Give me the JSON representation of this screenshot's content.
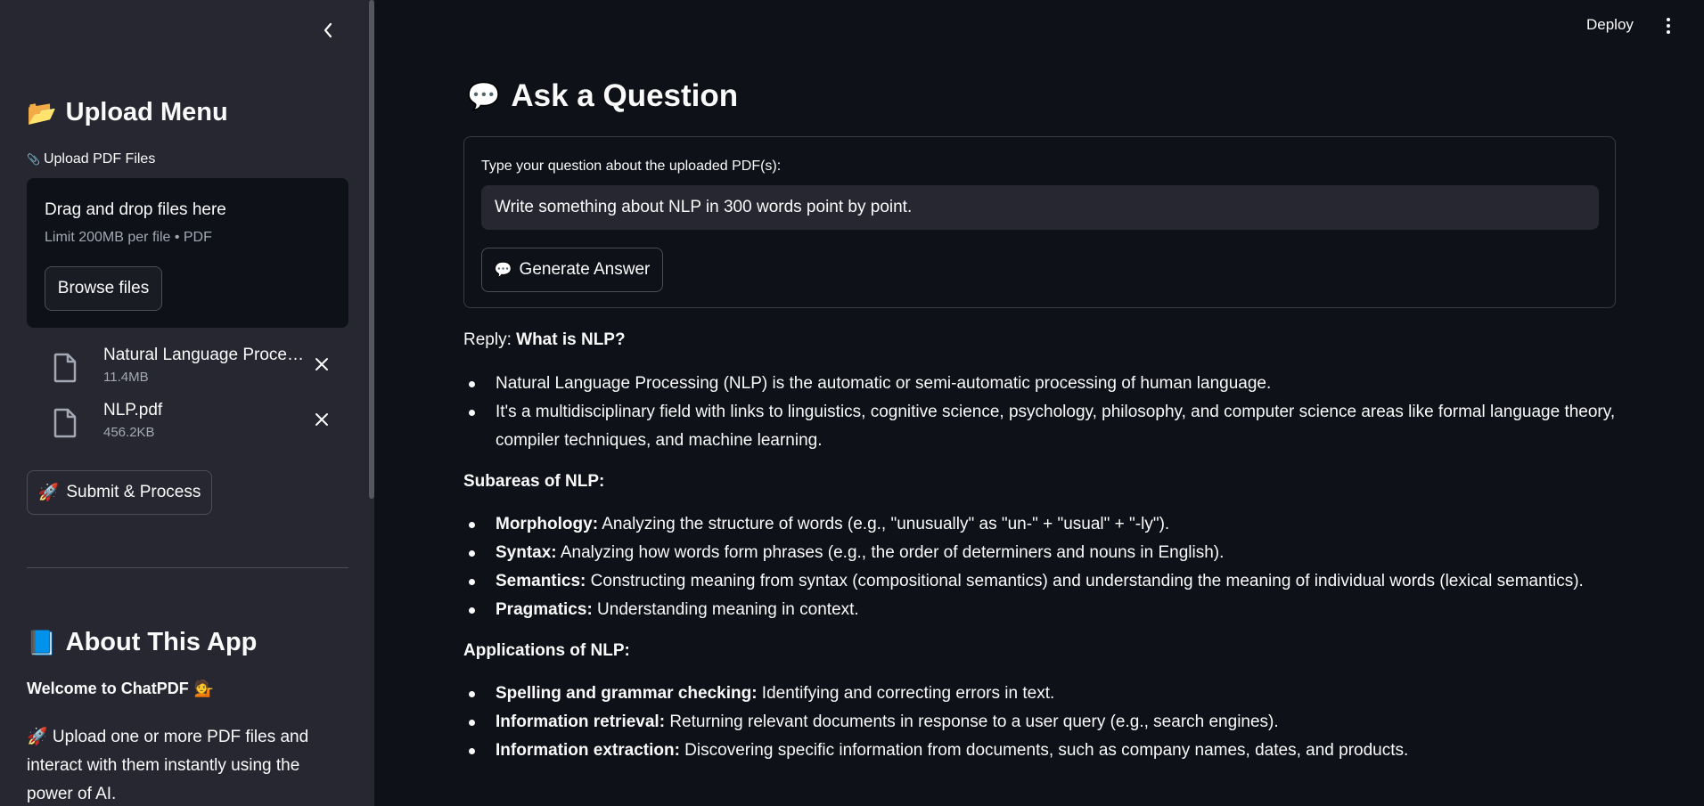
{
  "sidebar": {
    "upload_title": "Upload Menu",
    "upload_emoji": "📂",
    "upload_label": "Upload PDF Files",
    "upload_label_icon": "📎",
    "dropzone": {
      "title": "Drag and drop files here",
      "limit": "Limit 200MB per file • PDF",
      "browse_label": "Browse files"
    },
    "files": [
      {
        "name": "Natural Language Processing.pdf",
        "size": "11.4MB"
      },
      {
        "name": "NLP.pdf",
        "size": "456.2KB"
      }
    ],
    "submit_label": "Submit & Process",
    "submit_emoji": "🚀",
    "about_title": "About This App",
    "about_emoji": "📘",
    "welcome": "Welcome to ChatPDF",
    "welcome_emoji": "💁",
    "about_text": "🚀 Upload one or more PDF files and interact with them instantly using the power of AI."
  },
  "header": {
    "deploy_label": "Deploy"
  },
  "main": {
    "title": "Ask a Question",
    "title_emoji": "💬",
    "input_label": "Type your question about the uploaded PDF(s):",
    "input_value": "Write something about NLP in 300 words point by point.",
    "generate_label": "Generate Answer",
    "reply_prefix": "Reply:",
    "reply_heading": "What is NLP?",
    "what_is": [
      "Natural Language Processing (NLP) is the automatic or semi-automatic processing of human language.",
      "It's a multidisciplinary field with links to linguistics, cognitive science, psychology, philosophy, and computer science areas like formal language theory, compiler techniques, and machine learning."
    ],
    "subareas_heading": "Subareas of NLP:",
    "subareas": [
      {
        "term": "Morphology:",
        "text": " Analyzing the structure of words (e.g., \"unusually\" as \"un-\" + \"usual\" + \"-ly\")."
      },
      {
        "term": "Syntax:",
        "text": " Analyzing how words form phrases (e.g., the order of determiners and nouns in English)."
      },
      {
        "term": "Semantics:",
        "text": " Constructing meaning from syntax (compositional semantics) and understanding the meaning of individual words (lexical semantics)."
      },
      {
        "term": "Pragmatics:",
        "text": " Understanding meaning in context."
      }
    ],
    "applications_heading": "Applications of NLP:",
    "applications": [
      {
        "term": "Spelling and grammar checking:",
        "text": " Identifying and correcting errors in text."
      },
      {
        "term": "Information retrieval:",
        "text": " Returning relevant documents in response to a user query (e.g., search engines)."
      },
      {
        "term": "Information extraction:",
        "text": " Discovering specific information from documents, such as company names, dates, and products."
      }
    ]
  }
}
